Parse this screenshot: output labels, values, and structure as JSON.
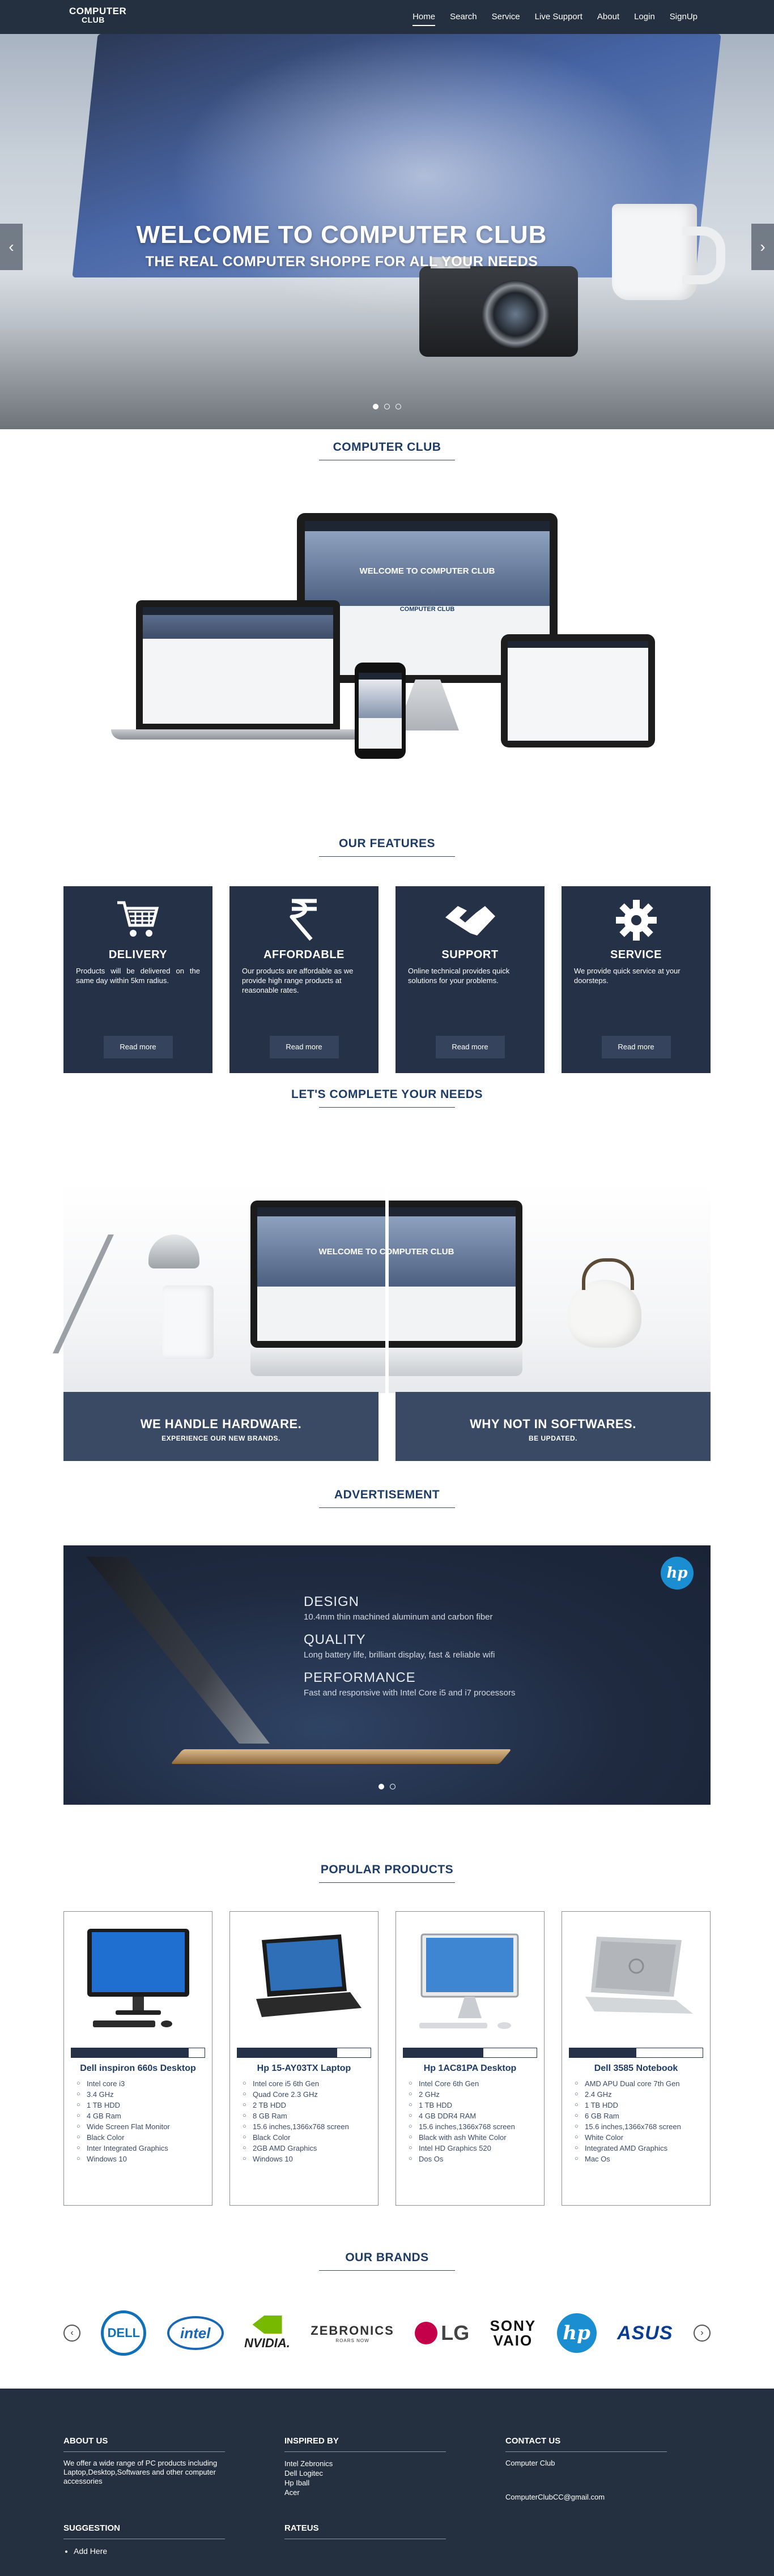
{
  "nav": {
    "logo_line1": "COMPUTER",
    "logo_line2": "CLUB",
    "links": [
      "Home",
      "Search",
      "Service",
      "Live Support",
      "About",
      "Login",
      "SignUp"
    ]
  },
  "hero": {
    "title": "WELCOME TO COMPUTER CLUB",
    "subtitle": "THE REAL COMPUTER SHOPPE FOR ALL YOUR NEEDS",
    "prev": "‹",
    "next": "›"
  },
  "sections": {
    "club": "COMPUTER CLUB",
    "features": "OUR FEATURES",
    "needs": "LET'S COMPLETE YOUR NEEDS",
    "ads": "ADVERTISEMENT",
    "products": "POPULAR PRODUCTS",
    "brands": "OUR BRANDS"
  },
  "mockup": {
    "screen_title": "WELCOME TO COMPUTER CLUB",
    "band_title": "COMPUTER CLUB"
  },
  "features": [
    {
      "title": "DELIVERY",
      "desc": "Products will be delivered on the same day within 5km radius.",
      "button": "Read more",
      "icon": "cart-icon"
    },
    {
      "title": "AFFORDABLE",
      "desc": "Our products are affordable as we provide high range products at reasonable rates.",
      "button": "Read more",
      "icon": "rupee-icon"
    },
    {
      "title": "SUPPORT",
      "desc": "Online technical provides quick solutions for your problems.",
      "button": "Read more",
      "icon": "handshake-icon"
    },
    {
      "title": "SERVICE",
      "desc": "We provide quick service at your doorsteps.",
      "button": "Read more",
      "icon": "gear-icon"
    }
  ],
  "needs": {
    "left_title": "WE HANDLE HARDWARE.",
    "left_sub": "EXPERIENCE OUR NEW BRANDS.",
    "right_title": "WHY NOT IN SOFTWARES.",
    "right_sub": "BE UPDATED.",
    "screen_title": "WELCOME TO COMPUTER CLUB"
  },
  "ad": {
    "logo": "hp",
    "items": [
      {
        "h": "DESIGN",
        "p": "10.4mm thin machined aluminum and carbon fiber"
      },
      {
        "h": "QUALITY",
        "p": "Long battery life, brilliant display, fast & reliable wifi"
      },
      {
        "h": "PERFORMANCE",
        "p": "Fast and responsive with Intel Core i5 and i7 processors"
      }
    ]
  },
  "products": [
    {
      "name": "Dell inspiron 660s Desktop",
      "rating": 0.88,
      "specs": [
        "Intel core i3",
        "3.4 GHz",
        "1 TB HDD",
        "4 GB Ram",
        "Wide Screen Flat Monitor",
        "Black Color",
        "Inter Integrated Graphics",
        "Windows 10"
      ]
    },
    {
      "name": "Hp 15-AY03TX Laptop",
      "rating": 0.75,
      "specs": [
        "Intel core i5 6th Gen",
        "Quad Core 2.3 GHz",
        "2 TB HDD",
        "8 GB Ram",
        "15.6 inches,1366x768 screen",
        "Black Color",
        "2GB AMD Graphics",
        "Windows 10"
      ]
    },
    {
      "name": "Hp 1AC81PA Desktop",
      "rating": 0.6,
      "specs": [
        "Intel Core 6th Gen",
        "2 GHz",
        "1 TB HDD",
        "4 GB DDR4 RAM",
        "15.6 inches,1366x768 screen",
        "Black with ash White Color",
        "Intel HD Graphics 520",
        "Dos Os"
      ]
    },
    {
      "name": "Dell 3585 Notebook",
      "rating": 0.5,
      "specs": [
        "AMD APU Dual core 7th Gen",
        "2.4 GHz",
        "1 TB HDD",
        "6 GB Ram",
        "15.6 inches,1366x768 screen",
        "White Color",
        "Integrated AMD Graphics",
        "Mac Os"
      ]
    }
  ],
  "brands": [
    {
      "name": "DELL",
      "icon": "dell-logo"
    },
    {
      "name": "intel",
      "icon": "intel-logo"
    },
    {
      "name": "NVIDIA.",
      "icon": "nvidia-logo"
    },
    {
      "name": "ZEBRONICS",
      "tag": "ROARS NOW",
      "icon": "zebronics-logo"
    },
    {
      "name": "LG",
      "icon": "lg-logo"
    },
    {
      "name": "SONY",
      "tag": "VAIO",
      "icon": "sony-vaio-logo"
    },
    {
      "name": "hp",
      "icon": "hp-logo"
    },
    {
      "name": "ASUS",
      "icon": "asus-logo"
    }
  ],
  "footer": {
    "about_h": "ABOUT US",
    "about_t": "We offer a wide range of PC products including Laptop,Desktop,Softwares and other computer accessories",
    "inspired_h": "INSPIRED BY",
    "inspired": [
      "Intel Zebronics",
      "Dell Logitec",
      "Hp Iball",
      "Acer"
    ],
    "contact_h": "CONTACT US",
    "contact_name": "Computer Club",
    "contact_email": "ComputerClubCC@gmail.com",
    "suggestion_h": "SUGGESTION",
    "suggestion_link": "Add Here",
    "rateus_h": "RATEUS"
  },
  "colors": {
    "navy": "#24303f",
    "panel": "#243147",
    "accent": "#1e3c68",
    "hp_blue": "#1a8ed1"
  }
}
